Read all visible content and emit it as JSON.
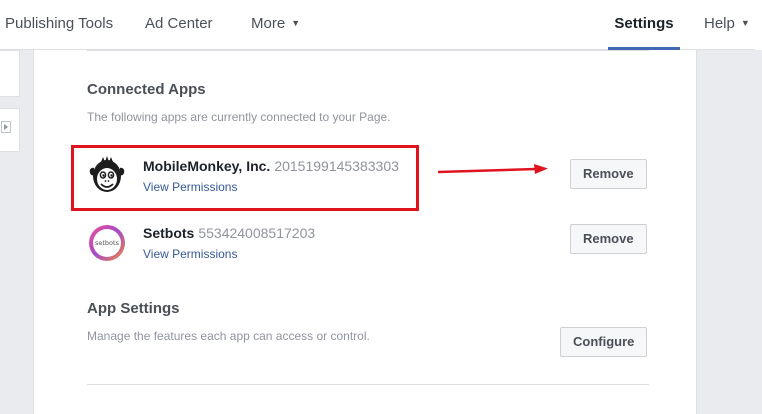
{
  "nav": {
    "items": [
      {
        "label": "Publishing Tools",
        "active": false
      },
      {
        "label": "Ad Center",
        "active": false
      },
      {
        "label": "More",
        "active": false
      },
      {
        "label": "Settings",
        "active": true
      },
      {
        "label": "Help",
        "active": false
      }
    ],
    "more_caret": "▼",
    "help_caret": "▼"
  },
  "connected_apps": {
    "title": "Connected Apps",
    "description": "The following apps are currently connected to your Page.",
    "apps": [
      {
        "name": "MobileMonkey, Inc.",
        "id": "2015199145383303",
        "link": "View Permissions",
        "button": "Remove",
        "logo_icon": "monkey-logo-icon",
        "logo_text": ""
      },
      {
        "name": "Setbots",
        "id": "553424008517203",
        "link": "View Permissions",
        "button": "Remove",
        "logo_icon": "setbots-logo-icon",
        "logo_text": "setbots"
      }
    ]
  },
  "app_settings": {
    "title": "App Settings",
    "description": "Manage the features each app can access or control.",
    "button": "Configure"
  },
  "colors": {
    "accent": "#4267b2",
    "link": "#365899",
    "annotation": "#e0141e"
  }
}
